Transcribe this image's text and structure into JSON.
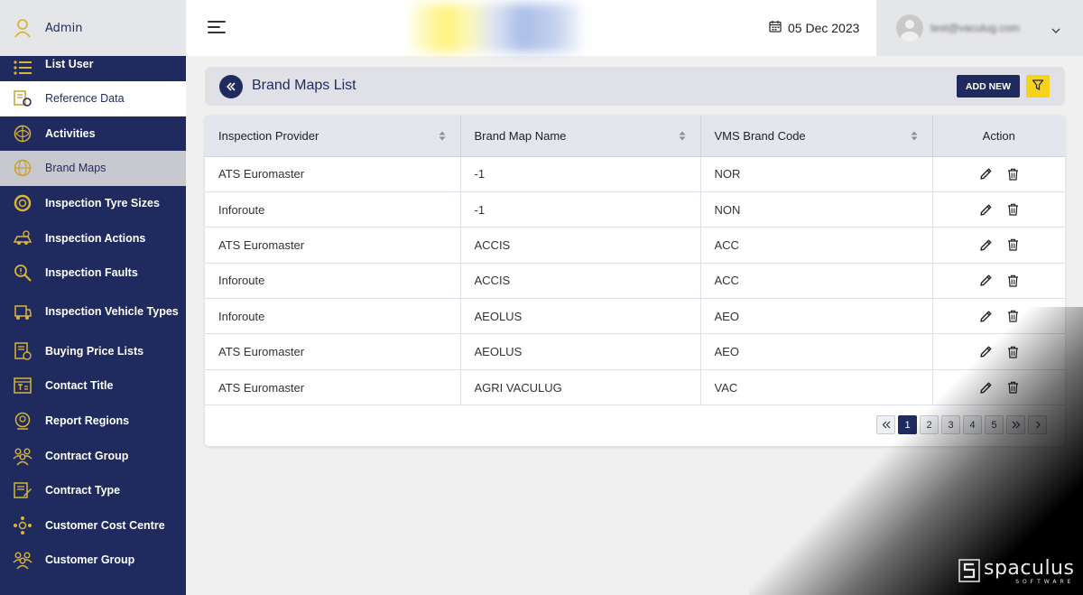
{
  "sidebar": {
    "user_name": "Admin",
    "items": [
      {
        "label": "List User",
        "icon": "list-icon"
      },
      {
        "label": "Reference Data",
        "icon": "reference-data-icon"
      },
      {
        "label": "Activities",
        "icon": "activities-icon"
      },
      {
        "label": "Brand Maps",
        "icon": "brand-maps-icon"
      },
      {
        "label": "Inspection Tyre Sizes",
        "icon": "tyre-icon"
      },
      {
        "label": "Inspection Actions",
        "icon": "inspection-actions-icon"
      },
      {
        "label": "Inspection Faults",
        "icon": "inspection-faults-icon"
      },
      {
        "label": "Inspection Vehicle Types",
        "icon": "vehicle-icon"
      },
      {
        "label": "Buying Price Lists",
        "icon": "price-list-icon"
      },
      {
        "label": "Contact Title",
        "icon": "contact-title-icon"
      },
      {
        "label": "Report Regions",
        "icon": "report-regions-icon"
      },
      {
        "label": "Contract Group",
        "icon": "group-icon"
      },
      {
        "label": "Contract Type",
        "icon": "contract-type-icon"
      },
      {
        "label": "Customer Cost Centre",
        "icon": "cost-centre-icon"
      },
      {
        "label": "Customer Group",
        "icon": "group-icon"
      }
    ]
  },
  "header": {
    "date": "05 Dec 2023",
    "user_email": "test@vaculug.com"
  },
  "page": {
    "title": "Brand Maps List",
    "add_new_label": "ADD NEW"
  },
  "table": {
    "columns": [
      "Inspection Provider",
      "Brand Map Name",
      "VMS Brand Code",
      "Action"
    ],
    "rows": [
      {
        "provider": "ATS Euromaster",
        "name": "-1",
        "code": "NOR"
      },
      {
        "provider": "Inforoute",
        "name": "-1",
        "code": "NON"
      },
      {
        "provider": "ATS Euromaster",
        "name": "ACCIS",
        "code": "ACC"
      },
      {
        "provider": "Inforoute",
        "name": "ACCIS",
        "code": "ACC"
      },
      {
        "provider": "Inforoute",
        "name": "AEOLUS",
        "code": "AEO"
      },
      {
        "provider": "ATS Euromaster",
        "name": "AEOLUS",
        "code": "AEO"
      },
      {
        "provider": "ATS Euromaster",
        "name": "AGRI VACULUG",
        "code": "VAC"
      }
    ]
  },
  "pagination": {
    "pages": [
      "1",
      "2",
      "3",
      "4",
      "5"
    ],
    "current": "1"
  },
  "watermark": {
    "name": "spaculus",
    "sub": "SOFTWARE"
  },
  "colors": {
    "navy": "#1f2a5e",
    "accent_yellow": "#f7d21a",
    "icon_gold": "#d9b43a"
  }
}
